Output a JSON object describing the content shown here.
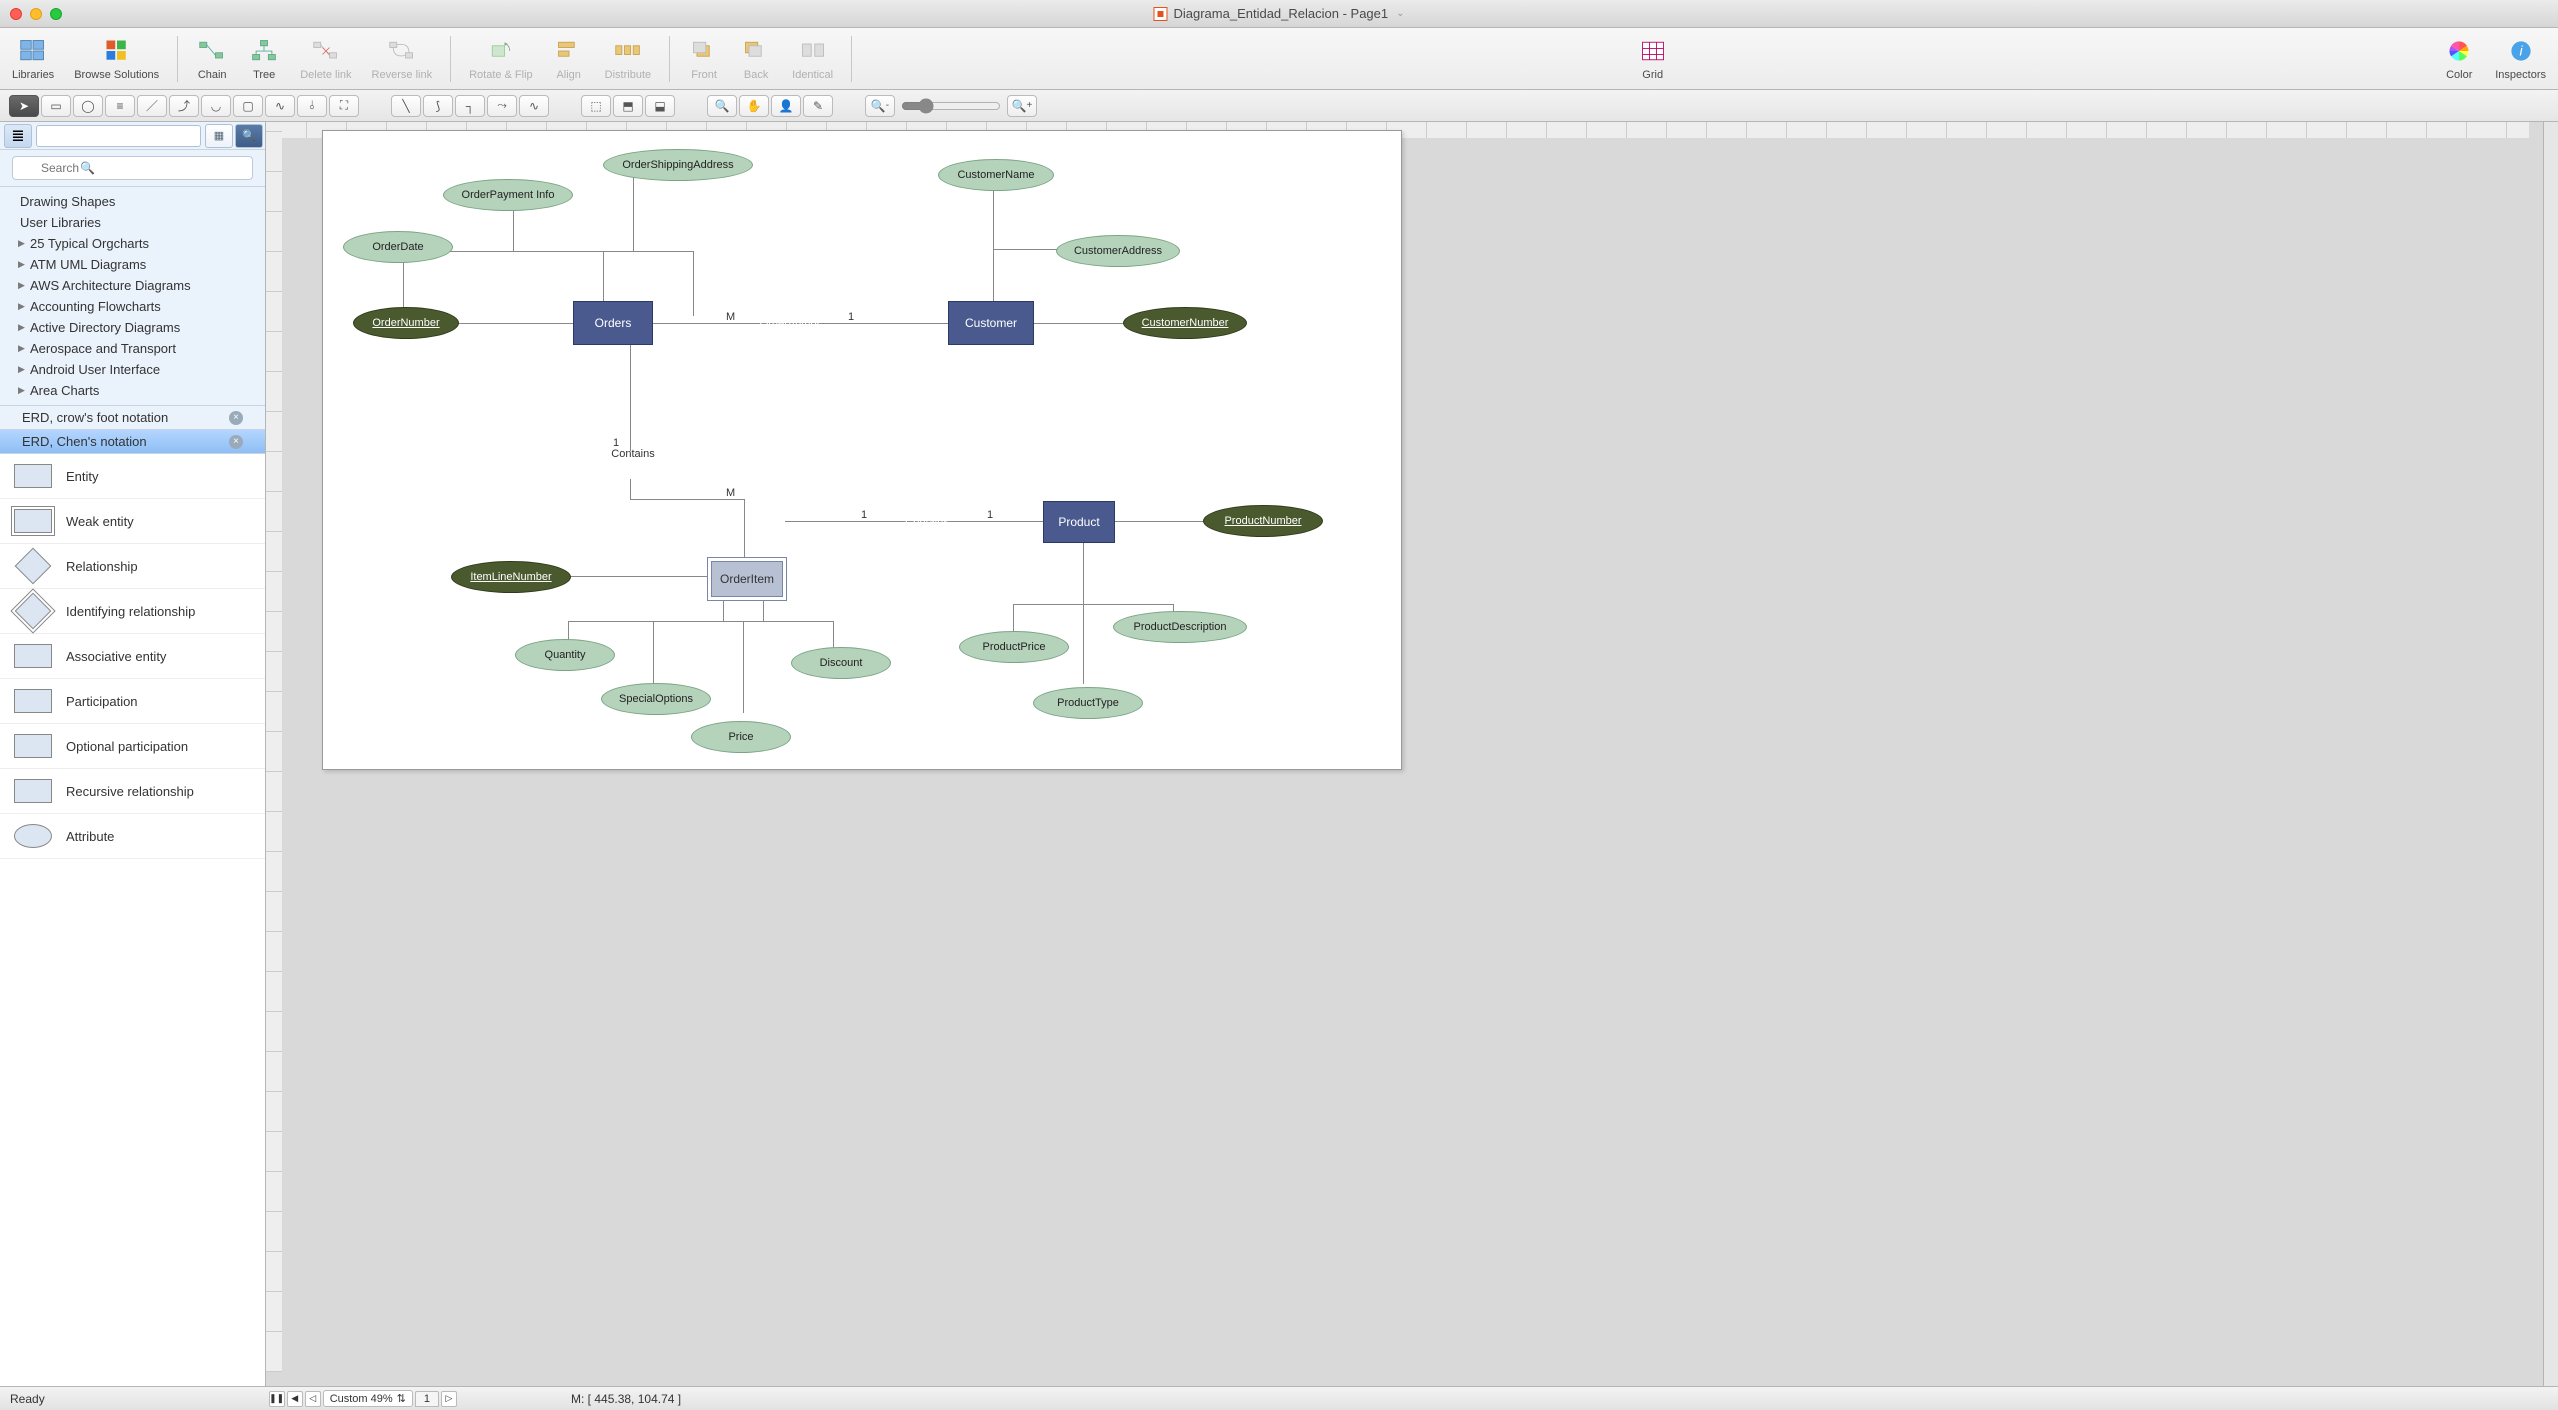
{
  "window": {
    "title": "Diagrama_Entidad_Relacion - Page1"
  },
  "toolbar": {
    "libraries": "Libraries",
    "browse": "Browse Solutions",
    "chain": "Chain",
    "tree": "Tree",
    "delete_link": "Delete link",
    "reverse_link": "Reverse link",
    "rotate_flip": "Rotate & Flip",
    "align": "Align",
    "distribute": "Distribute",
    "front": "Front",
    "back": "Back",
    "identical": "Identical",
    "grid": "Grid",
    "color": "Color",
    "inspectors": "Inspectors"
  },
  "search": {
    "placeholder": "Search"
  },
  "tree": {
    "items": [
      "Drawing Shapes",
      "User Libraries",
      "25 Typical Orgcharts",
      "ATM UML Diagrams",
      "AWS Architecture Diagrams",
      "Accounting Flowcharts",
      "Active Directory Diagrams",
      "Aerospace and Transport",
      "Android User Interface",
      "Area Charts"
    ]
  },
  "sb_tabs": {
    "crow": "ERD, crow's foot notation",
    "chen": "ERD, Chen's notation"
  },
  "shapes": {
    "entity": "Entity",
    "weak_entity": "Weak entity",
    "relationship": "Relationship",
    "identifying": "Identifying relationship",
    "assoc": "Associative entity",
    "participation": "Participation",
    "optional": "Optional participation",
    "recursive": "Recursive relationship",
    "attribute": "Attribute"
  },
  "erd": {
    "orders": "Orders",
    "customer": "Customer",
    "product": "Product",
    "orderitem": "OrderItem",
    "order_author": "OrderAuthor",
    "contains1": "Contains",
    "contains2": "Contains",
    "order_date": "OrderDate",
    "order_payment": "OrderPayment Info",
    "order_ship": "OrderShippingAddress",
    "order_number": "OrderNumber",
    "customer_name": "CustomerName",
    "customer_address": "CustomerAddress",
    "customer_number": "CustomerNumber",
    "item_line": "ItemLineNumber",
    "quantity": "Quantity",
    "special": "SpecialOptions",
    "price": "Price",
    "discount": "Discount",
    "product_number": "ProductNumber",
    "product_price": "ProductPrice",
    "product_desc": "ProductDescription",
    "product_type": "ProductType",
    "card_M1": "M",
    "card_1a": "1",
    "card_1b": "1",
    "card_M2": "M",
    "card_1c": "1",
    "card_1d": "1"
  },
  "status": {
    "ready": "Ready",
    "zoom": "Custom 49%",
    "mouse": "M: [ 445.38, 104.74 ]",
    "page_tab": "1"
  }
}
